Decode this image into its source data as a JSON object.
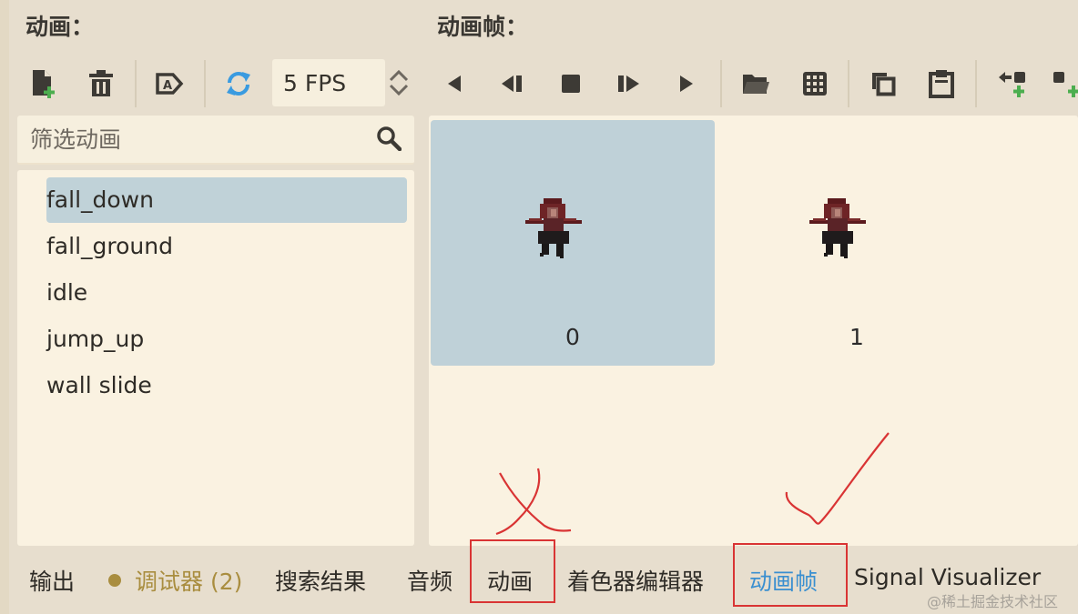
{
  "headers": {
    "animations": "动画：",
    "frames": "动画帧："
  },
  "toolbar": {
    "buttons": [
      {
        "name": "new-animation-icon",
        "label": "new animation"
      },
      {
        "name": "delete-animation-icon",
        "label": "delete"
      },
      {
        "name": "autoplay-icon",
        "label": "autoplay"
      },
      {
        "name": "loop-icon",
        "label": "loop"
      },
      {
        "name": "play-backwards-start-icon"
      },
      {
        "name": "play-backwards-icon"
      },
      {
        "name": "stop-icon"
      },
      {
        "name": "play-icon"
      },
      {
        "name": "play-from-start-icon"
      },
      {
        "name": "load-frames-folder-icon"
      },
      {
        "name": "sprite-sheet-grid-icon"
      },
      {
        "name": "copy-frame-icon"
      },
      {
        "name": "paste-frame-icon"
      },
      {
        "name": "insert-frame-before-icon"
      },
      {
        "name": "insert-frame-after-icon"
      }
    ],
    "fps_value": "5 FPS"
  },
  "filter": {
    "placeholder": "筛选动画"
  },
  "animations": [
    {
      "label": "fall_down",
      "selected": true
    },
    {
      "label": "fall_ground",
      "selected": false
    },
    {
      "label": "idle",
      "selected": false
    },
    {
      "label": "jump_up",
      "selected": false
    },
    {
      "label": "wall slide",
      "selected": false
    }
  ],
  "frames": [
    {
      "label": "0",
      "selected": true
    },
    {
      "label": "1",
      "selected": false
    }
  ],
  "bottom_tabs": [
    {
      "label": "输出"
    },
    {
      "label": "调试器 (2)"
    },
    {
      "label": "搜索结果"
    },
    {
      "label": "音频"
    },
    {
      "label": "动画"
    },
    {
      "label": "着色器编辑器"
    },
    {
      "label": "动画帧"
    },
    {
      "label": "Signal Visualizer"
    }
  ],
  "watermark": "@稀土掘金技术社区",
  "colors": {
    "selection": "#c0d2d8",
    "active_tab": "#3a8fd0",
    "debugger": "#a98d3f",
    "annotation": "#d93434",
    "icon_green": "#4cae4f",
    "icon_blue": "#3a9be0"
  }
}
